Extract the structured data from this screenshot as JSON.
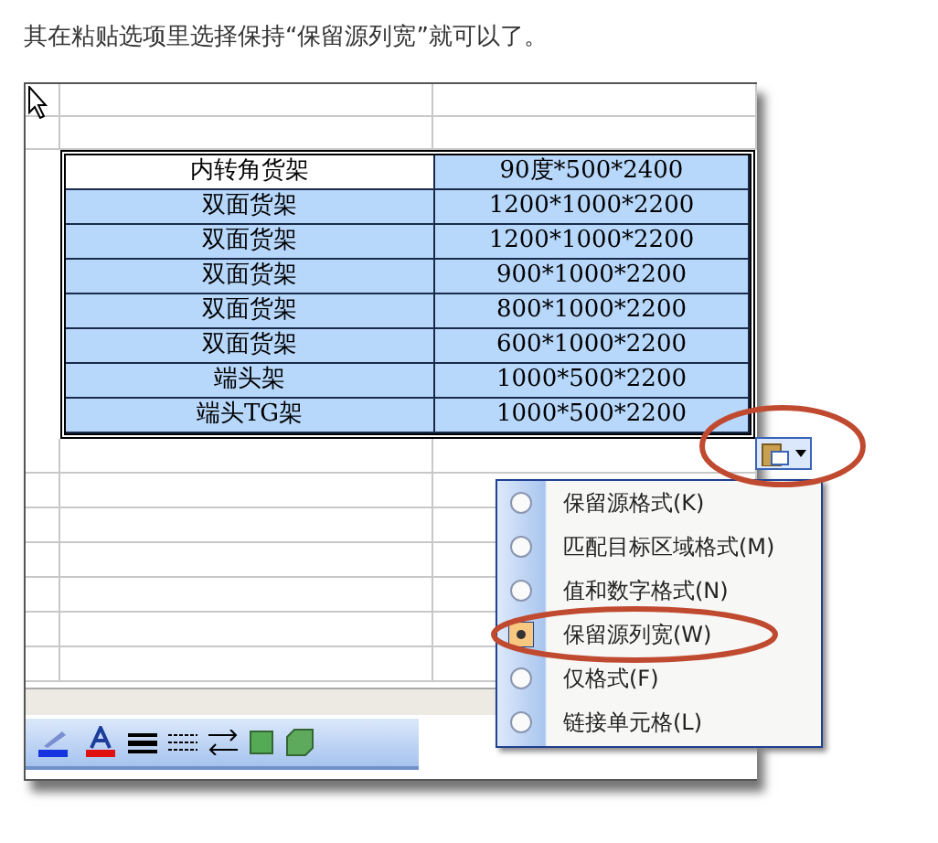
{
  "caption": "其在粘贴选项里选择保持“保留源列宽”就可以了。",
  "sheet": {
    "rows": [
      {
        "cells": [
          {
            "text": "内转角货架",
            "selected": false
          },
          {
            "text": "90度*500*2400",
            "selected": true
          }
        ]
      },
      {
        "cells": [
          {
            "text": "双面货架",
            "selected": true
          },
          {
            "text": "1200*1000*2200",
            "selected": true
          }
        ]
      },
      {
        "cells": [
          {
            "text": "双面货架",
            "selected": true
          },
          {
            "text": "1200*1000*2200",
            "selected": true
          }
        ]
      },
      {
        "cells": [
          {
            "text": "双面货架",
            "selected": true
          },
          {
            "text": "900*1000*2200",
            "selected": true
          }
        ]
      },
      {
        "cells": [
          {
            "text": "双面货架",
            "selected": true
          },
          {
            "text": "800*1000*2200",
            "selected": true
          }
        ]
      },
      {
        "cells": [
          {
            "text": "双面货架",
            "selected": true
          },
          {
            "text": "600*1000*2200",
            "selected": true
          }
        ]
      },
      {
        "cells": [
          {
            "text": "端头架",
            "selected": true
          },
          {
            "text": "1000*500*2200",
            "selected": true
          }
        ]
      },
      {
        "cells": [
          {
            "text": "端头TG架",
            "selected": true
          },
          {
            "text": "1000*500*2200",
            "selected": true
          }
        ]
      }
    ]
  },
  "paste_menu": {
    "items": [
      {
        "label": "保留源格式(K)",
        "selected": false
      },
      {
        "label": "匹配目标区域格式(M)",
        "selected": false
      },
      {
        "label": "值和数字格式(N)",
        "selected": false
      },
      {
        "label": "保留源列宽(W)",
        "selected": true
      },
      {
        "label": "仅格式(F)",
        "selected": false
      },
      {
        "label": "链接单元格(L)",
        "selected": false
      }
    ]
  }
}
